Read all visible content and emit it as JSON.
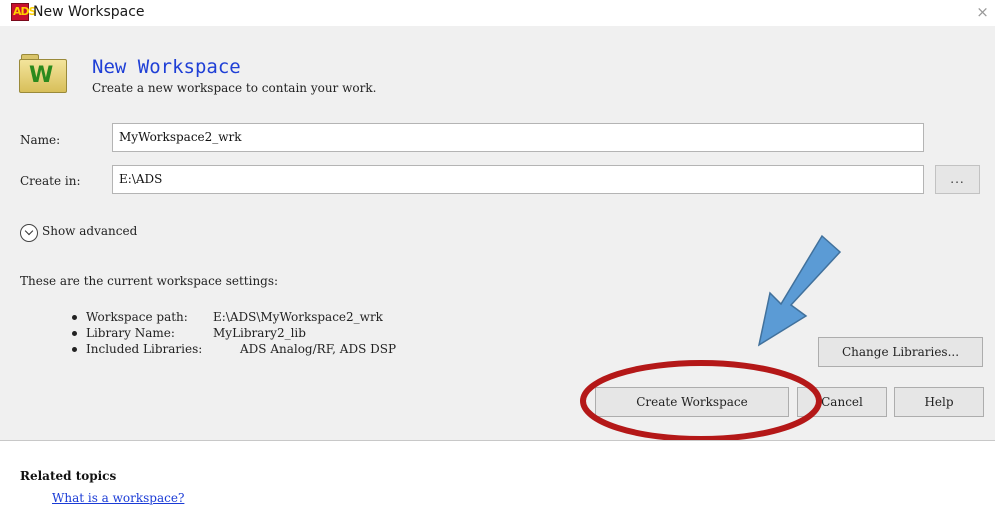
{
  "window": {
    "title": "New Workspace",
    "app_icon": "ads-app-icon",
    "close": "×"
  },
  "header": {
    "icon": "workspace-folder-icon",
    "icon_letter": "W",
    "title": "New Workspace",
    "subtitle": "Create a new workspace to contain your work."
  },
  "form": {
    "name_label": "Name:",
    "name_value": "MyWorkspace2_wrk",
    "create_in_label": "Create in:",
    "create_in_value": "E:\\ADS",
    "browse_label": "..."
  },
  "advanced": {
    "label": "Show advanced",
    "icon": "chevron-down-circle-icon"
  },
  "settings": {
    "heading": "These are the current workspace settings:",
    "items": [
      {
        "label": "Workspace path:",
        "value": "E:\\ADS\\MyWorkspace2_wrk"
      },
      {
        "label": "Library Name:",
        "value": "MyLibrary2_lib"
      },
      {
        "label": "Included Libraries:",
        "value": "ADS Analog/RF, ADS DSP"
      }
    ]
  },
  "buttons": {
    "change_libraries": "Change Libraries...",
    "create_workspace": "Create Workspace",
    "cancel": "Cancel",
    "help": "Help"
  },
  "annotation": {
    "arrow_color": "#5b9bd5",
    "ellipse_color": "#b41818"
  },
  "related": {
    "heading": "Related topics",
    "link": "What is a workspace?"
  }
}
